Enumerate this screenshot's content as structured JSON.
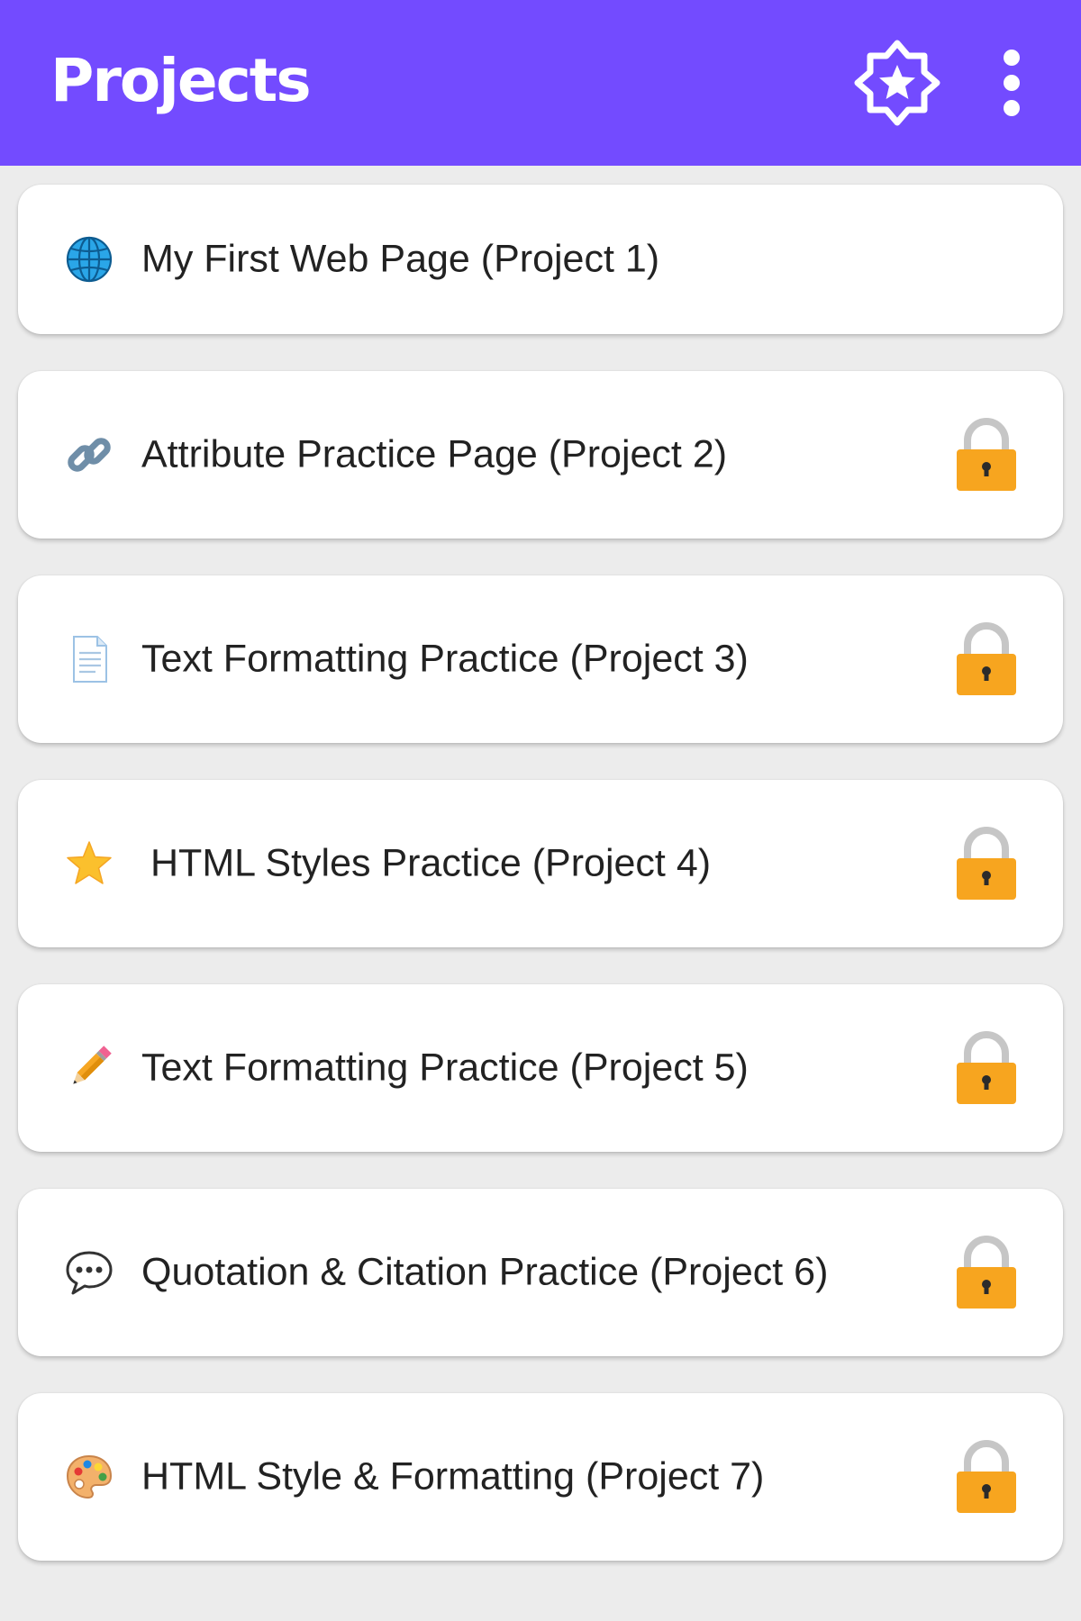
{
  "header": {
    "title": "Projects",
    "background_color": "#734bff",
    "badge_icon": "star-badge-icon",
    "menu_icon": "more-vert-icon"
  },
  "projects": [
    {
      "label": "My First Web Page (Project 1)",
      "icon": "globe-icon",
      "locked": false
    },
    {
      "label": "Attribute Practice Page (Project 2)",
      "icon": "link-icon",
      "locked": true
    },
    {
      "label": "Text Formatting Practice (Project 3)",
      "icon": "document-icon",
      "locked": true
    },
    {
      "label": "HTML Styles Practice (Project 4)",
      "icon": "star-icon",
      "locked": true
    },
    {
      "label": "Text Formatting Practice (Project 5)",
      "icon": "pencil-icon",
      "locked": true
    },
    {
      "label": "Quotation & Citation Practice (Project 6)",
      "icon": "speech-bubble-icon",
      "locked": true
    },
    {
      "label": "HTML Style & Formatting (Project 7)",
      "icon": "palette-icon",
      "locked": true
    }
  ],
  "colors": {
    "page_background": "#ececec",
    "card_background": "#ffffff",
    "lock": "#f7a51f"
  }
}
